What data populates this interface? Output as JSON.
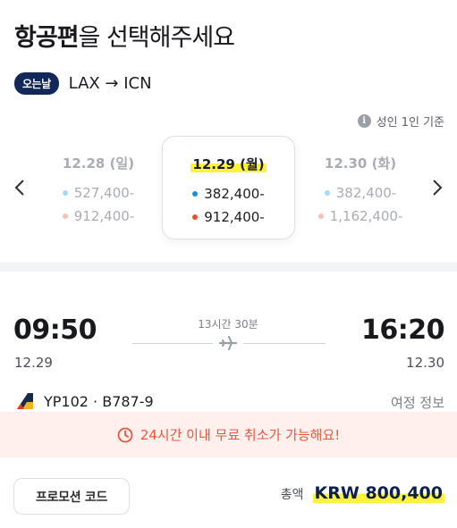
{
  "header": {
    "title_bold": "항공편",
    "title_rest": "을 선택해주세요"
  },
  "route": {
    "badge": "오는날",
    "text": "LAX → ICN"
  },
  "passenger": {
    "info_icon": "info-icon",
    "text": "성인 1인 기준"
  },
  "date_selector": {
    "prev_icon": "chevron-left-icon",
    "next_icon": "chevron-right-icon",
    "dates": [
      {
        "label": "12.28 (일)",
        "price_a": "527,400-",
        "price_b": "912,400-",
        "selected": false
      },
      {
        "label": "12.29 (월)",
        "price_a": "382,400-",
        "price_b": "912,400-",
        "selected": true
      },
      {
        "label": "12.30 (화)",
        "price_a": "382,400-",
        "price_b": "1,162,400-",
        "selected": false
      }
    ],
    "colors": {
      "dot_a": "#1a8fd8",
      "dot_b": "#e8502e",
      "dot_a_muted": "#a8d8f2",
      "dot_b_muted": "#f6c2b6",
      "highlight": "#fff23a"
    }
  },
  "flight": {
    "depart_time": "09:50",
    "depart_date": "12.29",
    "arrive_time": "16:20",
    "arrive_date": "12.30",
    "duration": "13시간 30분",
    "flight_info": "YP102 · B787-9",
    "itinerary_link": "여정 정보",
    "airline_logo": "airline-logo",
    "plane_icon": "airplane-icon"
  },
  "notice": {
    "icon": "clock-icon",
    "text": "24시간 이내 무료 취소가 가능해요!",
    "color": "#e8573d",
    "background": "#fff0ee"
  },
  "footer": {
    "promo_label": "프로모션 코드",
    "total_label": "총액",
    "total_amount": "KRW 800,400"
  }
}
